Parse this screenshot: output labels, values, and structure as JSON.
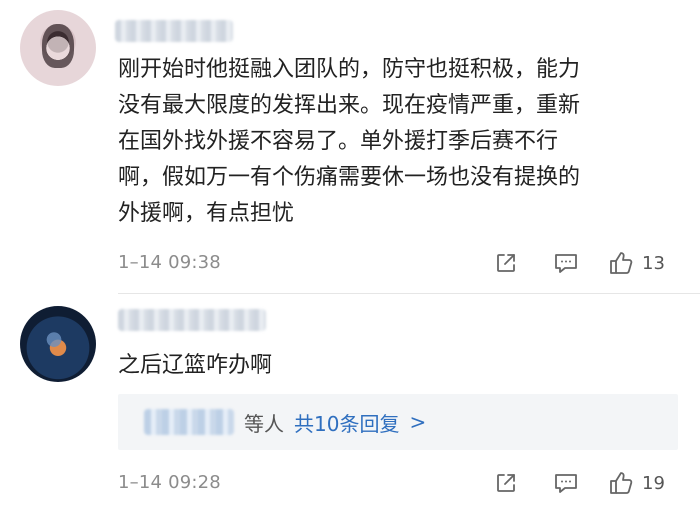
{
  "comments": [
    {
      "text": "刚开始时他挺融入团队的，防守也挺积极，能力\n没有最大限度的发挥出来。现在疫情严重，重新\n在国外找外援不容易了。单外援打季后赛不行\n啊，假如万一有个伤痛需要休一场也没有提换的\n外援啊，有点担忧",
      "time": "1–14 09:38",
      "likes": "13"
    },
    {
      "text": "之后辽篮咋办啊",
      "time": "1–14 09:28",
      "likes": "19",
      "replies": {
        "others_label": "等人",
        "count_label": "共10条回复",
        "chevron": ">"
      }
    }
  ],
  "icons": {
    "share": "share-icon",
    "reply": "comment-icon",
    "like": "thumbs-up-icon"
  },
  "colors": {
    "link": "#2f6fbf",
    "meta": "#8c8c8c",
    "text": "#222222",
    "reply_bg": "#f3f5f7",
    "divider": "#e6e6e6"
  }
}
